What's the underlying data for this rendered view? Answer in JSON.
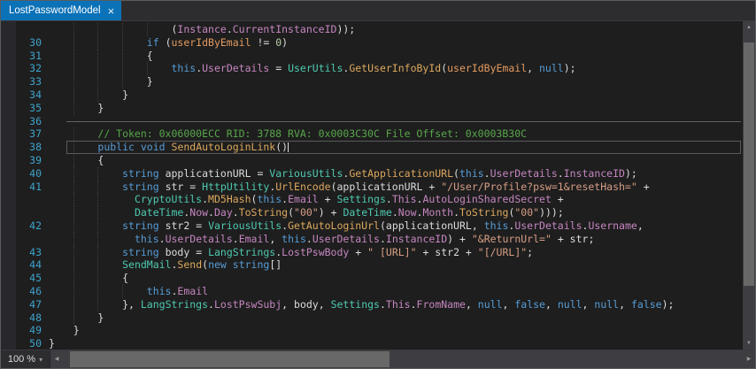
{
  "tab_bar": {
    "tabs": [
      {
        "label": "LostPasswordModel",
        "active": true
      }
    ]
  },
  "icons": {
    "tab_close": "×",
    "scroll_up": "▲",
    "scroll_down": "▼",
    "scroll_left": "◀",
    "scroll_right": "▶",
    "zoom_dropdown": "▾"
  },
  "status_bar": {
    "zoom_level": "100 %"
  },
  "editor": {
    "syntax_colors": {
      "keyword": "#569CD6",
      "type": "#4EC9B0",
      "method": "#DCA85E",
      "property": "#C586C0",
      "parameter": "#E39A5F",
      "string": "#D69D85",
      "comment": "#57A64A",
      "number": "#B5CEA8",
      "plain": "#DCDCDC",
      "line_number": "#3FA3CC",
      "background": "#1E1E1E",
      "active_tab": "#0B72B8"
    },
    "lines": [
      {
        "n": "",
        "i": 20,
        "t": [
          [
            "pl",
            "("
          ],
          [
            "pr",
            "Instance"
          ],
          [
            "pl",
            "."
          ],
          [
            "pr",
            "CurrentInstanceID"
          ],
          [
            "pl",
            "));"
          ]
        ]
      },
      {
        "n": "30",
        "i": 16,
        "t": [
          [
            "kw",
            "if"
          ],
          [
            "pl",
            " ("
          ],
          [
            "pa",
            "userIdByEmail"
          ],
          [
            "pl",
            " != "
          ],
          [
            "nu",
            "0"
          ],
          [
            "pl",
            ")"
          ]
        ]
      },
      {
        "n": "31",
        "i": 16,
        "t": [
          [
            "pl",
            "{"
          ]
        ]
      },
      {
        "n": "32",
        "i": 20,
        "t": [
          [
            "kw",
            "this"
          ],
          [
            "pl",
            "."
          ],
          [
            "pr",
            "UserDetails"
          ],
          [
            "pl",
            " = "
          ],
          [
            "ty",
            "UserUtils"
          ],
          [
            "pl",
            "."
          ],
          [
            "m",
            "GetUserInfoById"
          ],
          [
            "pl",
            "("
          ],
          [
            "pa",
            "userIdByEmail"
          ],
          [
            "pl",
            ", "
          ],
          [
            "kw",
            "null"
          ],
          [
            "pl",
            ");"
          ]
        ]
      },
      {
        "n": "33",
        "i": 16,
        "t": [
          [
            "pl",
            "}"
          ]
        ]
      },
      {
        "n": "34",
        "i": 12,
        "t": [
          [
            "pl",
            "}"
          ]
        ]
      },
      {
        "n": "35",
        "i": 8,
        "t": [
          [
            "pl",
            "}"
          ]
        ]
      },
      {
        "n": "36",
        "i": 0,
        "hr": true,
        "t": []
      },
      {
        "n": "37",
        "i": 8,
        "t": [
          [
            "c",
            "// Token: 0x06000ECC RID: 3788 RVA: 0x0003C30C File Offset: 0x0003B30C"
          ]
        ]
      },
      {
        "n": "38",
        "i": 8,
        "cur": true,
        "caret": true,
        "t": [
          [
            "kw",
            "public"
          ],
          [
            "pl",
            " "
          ],
          [
            "kw",
            "void"
          ],
          [
            "pl",
            " "
          ],
          [
            "m",
            "SendAutoLoginLink"
          ],
          [
            "pl",
            "()"
          ]
        ]
      },
      {
        "n": "39",
        "i": 8,
        "t": [
          [
            "pl",
            "{"
          ]
        ]
      },
      {
        "n": "40",
        "i": 12,
        "t": [
          [
            "kw",
            "string"
          ],
          [
            "pl",
            " "
          ],
          [
            "loc",
            "applicationURL"
          ],
          [
            "pl",
            " = "
          ],
          [
            "ty",
            "VariousUtils"
          ],
          [
            "pl",
            "."
          ],
          [
            "m",
            "GetApplicationURL"
          ],
          [
            "pl",
            "("
          ],
          [
            "kw",
            "this"
          ],
          [
            "pl",
            "."
          ],
          [
            "pr",
            "UserDetails"
          ],
          [
            "pl",
            "."
          ],
          [
            "pr",
            "InstanceID"
          ],
          [
            "pl",
            ");"
          ]
        ]
      },
      {
        "n": "41",
        "i": 12,
        "t": [
          [
            "kw",
            "string"
          ],
          [
            "pl",
            " "
          ],
          [
            "loc",
            "str"
          ],
          [
            "pl",
            " = "
          ],
          [
            "ty",
            "HttpUtility"
          ],
          [
            "pl",
            "."
          ],
          [
            "m",
            "UrlEncode"
          ],
          [
            "pl",
            "("
          ],
          [
            "loc",
            "applicationURL"
          ],
          [
            "pl",
            " + "
          ],
          [
            "s",
            "\"/User/Profile?psw=1&resetHash=\""
          ],
          [
            "pl",
            " +"
          ]
        ]
      },
      {
        "n": "",
        "i": 14,
        "t": [
          [
            "ty",
            "CryptoUtils"
          ],
          [
            "pl",
            "."
          ],
          [
            "m",
            "MD5Hash"
          ],
          [
            "pl",
            "("
          ],
          [
            "kw",
            "this"
          ],
          [
            "pl",
            "."
          ],
          [
            "pr",
            "Email"
          ],
          [
            "pl",
            " + "
          ],
          [
            "ty",
            "Settings"
          ],
          [
            "pl",
            "."
          ],
          [
            "pr",
            "This"
          ],
          [
            "pl",
            "."
          ],
          [
            "pr",
            "AutoLoginSharedSecret"
          ],
          [
            "pl",
            " +"
          ]
        ]
      },
      {
        "n": "",
        "i": 14,
        "t": [
          [
            "ty",
            "DateTime"
          ],
          [
            "pl",
            "."
          ],
          [
            "pr",
            "Now"
          ],
          [
            "pl",
            "."
          ],
          [
            "pr",
            "Day"
          ],
          [
            "pl",
            "."
          ],
          [
            "m",
            "ToString"
          ],
          [
            "pl",
            "("
          ],
          [
            "s",
            "\"00\""
          ],
          [
            "pl",
            ") + "
          ],
          [
            "ty",
            "DateTime"
          ],
          [
            "pl",
            "."
          ],
          [
            "pr",
            "Now"
          ],
          [
            "pl",
            "."
          ],
          [
            "pr",
            "Month"
          ],
          [
            "pl",
            "."
          ],
          [
            "m",
            "ToString"
          ],
          [
            "pl",
            "("
          ],
          [
            "s",
            "\"00\""
          ],
          [
            "pl",
            ")));"
          ]
        ]
      },
      {
        "n": "42",
        "i": 12,
        "t": [
          [
            "kw",
            "string"
          ],
          [
            "pl",
            " "
          ],
          [
            "loc",
            "str2"
          ],
          [
            "pl",
            " = "
          ],
          [
            "ty",
            "VariousUtils"
          ],
          [
            "pl",
            "."
          ],
          [
            "m",
            "GetAutoLoginUrl"
          ],
          [
            "pl",
            "("
          ],
          [
            "loc",
            "applicationURL"
          ],
          [
            "pl",
            ", "
          ],
          [
            "kw",
            "this"
          ],
          [
            "pl",
            "."
          ],
          [
            "pr",
            "UserDetails"
          ],
          [
            "pl",
            "."
          ],
          [
            "pr",
            "Username"
          ],
          [
            "pl",
            ","
          ]
        ]
      },
      {
        "n": "",
        "i": 14,
        "t": [
          [
            "kw",
            "this"
          ],
          [
            "pl",
            "."
          ],
          [
            "pr",
            "UserDetails"
          ],
          [
            "pl",
            "."
          ],
          [
            "pr",
            "Email"
          ],
          [
            "pl",
            ", "
          ],
          [
            "kw",
            "this"
          ],
          [
            "pl",
            "."
          ],
          [
            "pr",
            "UserDetails"
          ],
          [
            "pl",
            "."
          ],
          [
            "pr",
            "InstanceID"
          ],
          [
            "pl",
            ") + "
          ],
          [
            "s",
            "\"&ReturnUrl=\""
          ],
          [
            "pl",
            " + "
          ],
          [
            "loc",
            "str"
          ],
          [
            "pl",
            ";"
          ]
        ]
      },
      {
        "n": "43",
        "i": 12,
        "t": [
          [
            "kw",
            "string"
          ],
          [
            "pl",
            " "
          ],
          [
            "loc",
            "body"
          ],
          [
            "pl",
            " = "
          ],
          [
            "ty",
            "LangStrings"
          ],
          [
            "pl",
            "."
          ],
          [
            "pr",
            "LostPswBody"
          ],
          [
            "pl",
            " + "
          ],
          [
            "s",
            "\" [URL]\""
          ],
          [
            "pl",
            " + "
          ],
          [
            "loc",
            "str2"
          ],
          [
            "pl",
            " + "
          ],
          [
            "s",
            "\"[/URL]\""
          ],
          [
            "pl",
            ";"
          ]
        ]
      },
      {
        "n": "44",
        "i": 12,
        "t": [
          [
            "ty",
            "SendMail"
          ],
          [
            "pl",
            "."
          ],
          [
            "m",
            "Send"
          ],
          [
            "pl",
            "("
          ],
          [
            "kw",
            "new"
          ],
          [
            "pl",
            " "
          ],
          [
            "kw",
            "string"
          ],
          [
            "pl",
            "[]"
          ]
        ]
      },
      {
        "n": "45",
        "i": 12,
        "t": [
          [
            "pl",
            "{"
          ]
        ]
      },
      {
        "n": "46",
        "i": 16,
        "t": [
          [
            "kw",
            "this"
          ],
          [
            "pl",
            "."
          ],
          [
            "pr",
            "Email"
          ]
        ]
      },
      {
        "n": "47",
        "i": 12,
        "t": [
          [
            "pl",
            "}, "
          ],
          [
            "ty",
            "LangStrings"
          ],
          [
            "pl",
            "."
          ],
          [
            "pr",
            "LostPswSubj"
          ],
          [
            "pl",
            ", "
          ],
          [
            "loc",
            "body"
          ],
          [
            "pl",
            ", "
          ],
          [
            "ty",
            "Settings"
          ],
          [
            "pl",
            "."
          ],
          [
            "pr",
            "This"
          ],
          [
            "pl",
            "."
          ],
          [
            "pr",
            "FromName"
          ],
          [
            "pl",
            ", "
          ],
          [
            "kw",
            "null"
          ],
          [
            "pl",
            ", "
          ],
          [
            "kw",
            "false"
          ],
          [
            "pl",
            ", "
          ],
          [
            "kw",
            "null"
          ],
          [
            "pl",
            ", "
          ],
          [
            "kw",
            "null"
          ],
          [
            "pl",
            ", "
          ],
          [
            "kw",
            "false"
          ],
          [
            "pl",
            ");"
          ]
        ]
      },
      {
        "n": "48",
        "i": 8,
        "t": [
          [
            "pl",
            "}"
          ]
        ]
      },
      {
        "n": "49",
        "i": 4,
        "t": [
          [
            "pl",
            "}"
          ]
        ]
      },
      {
        "n": "50",
        "i": 0,
        "t": [
          [
            "pl",
            "}"
          ]
        ]
      }
    ]
  }
}
